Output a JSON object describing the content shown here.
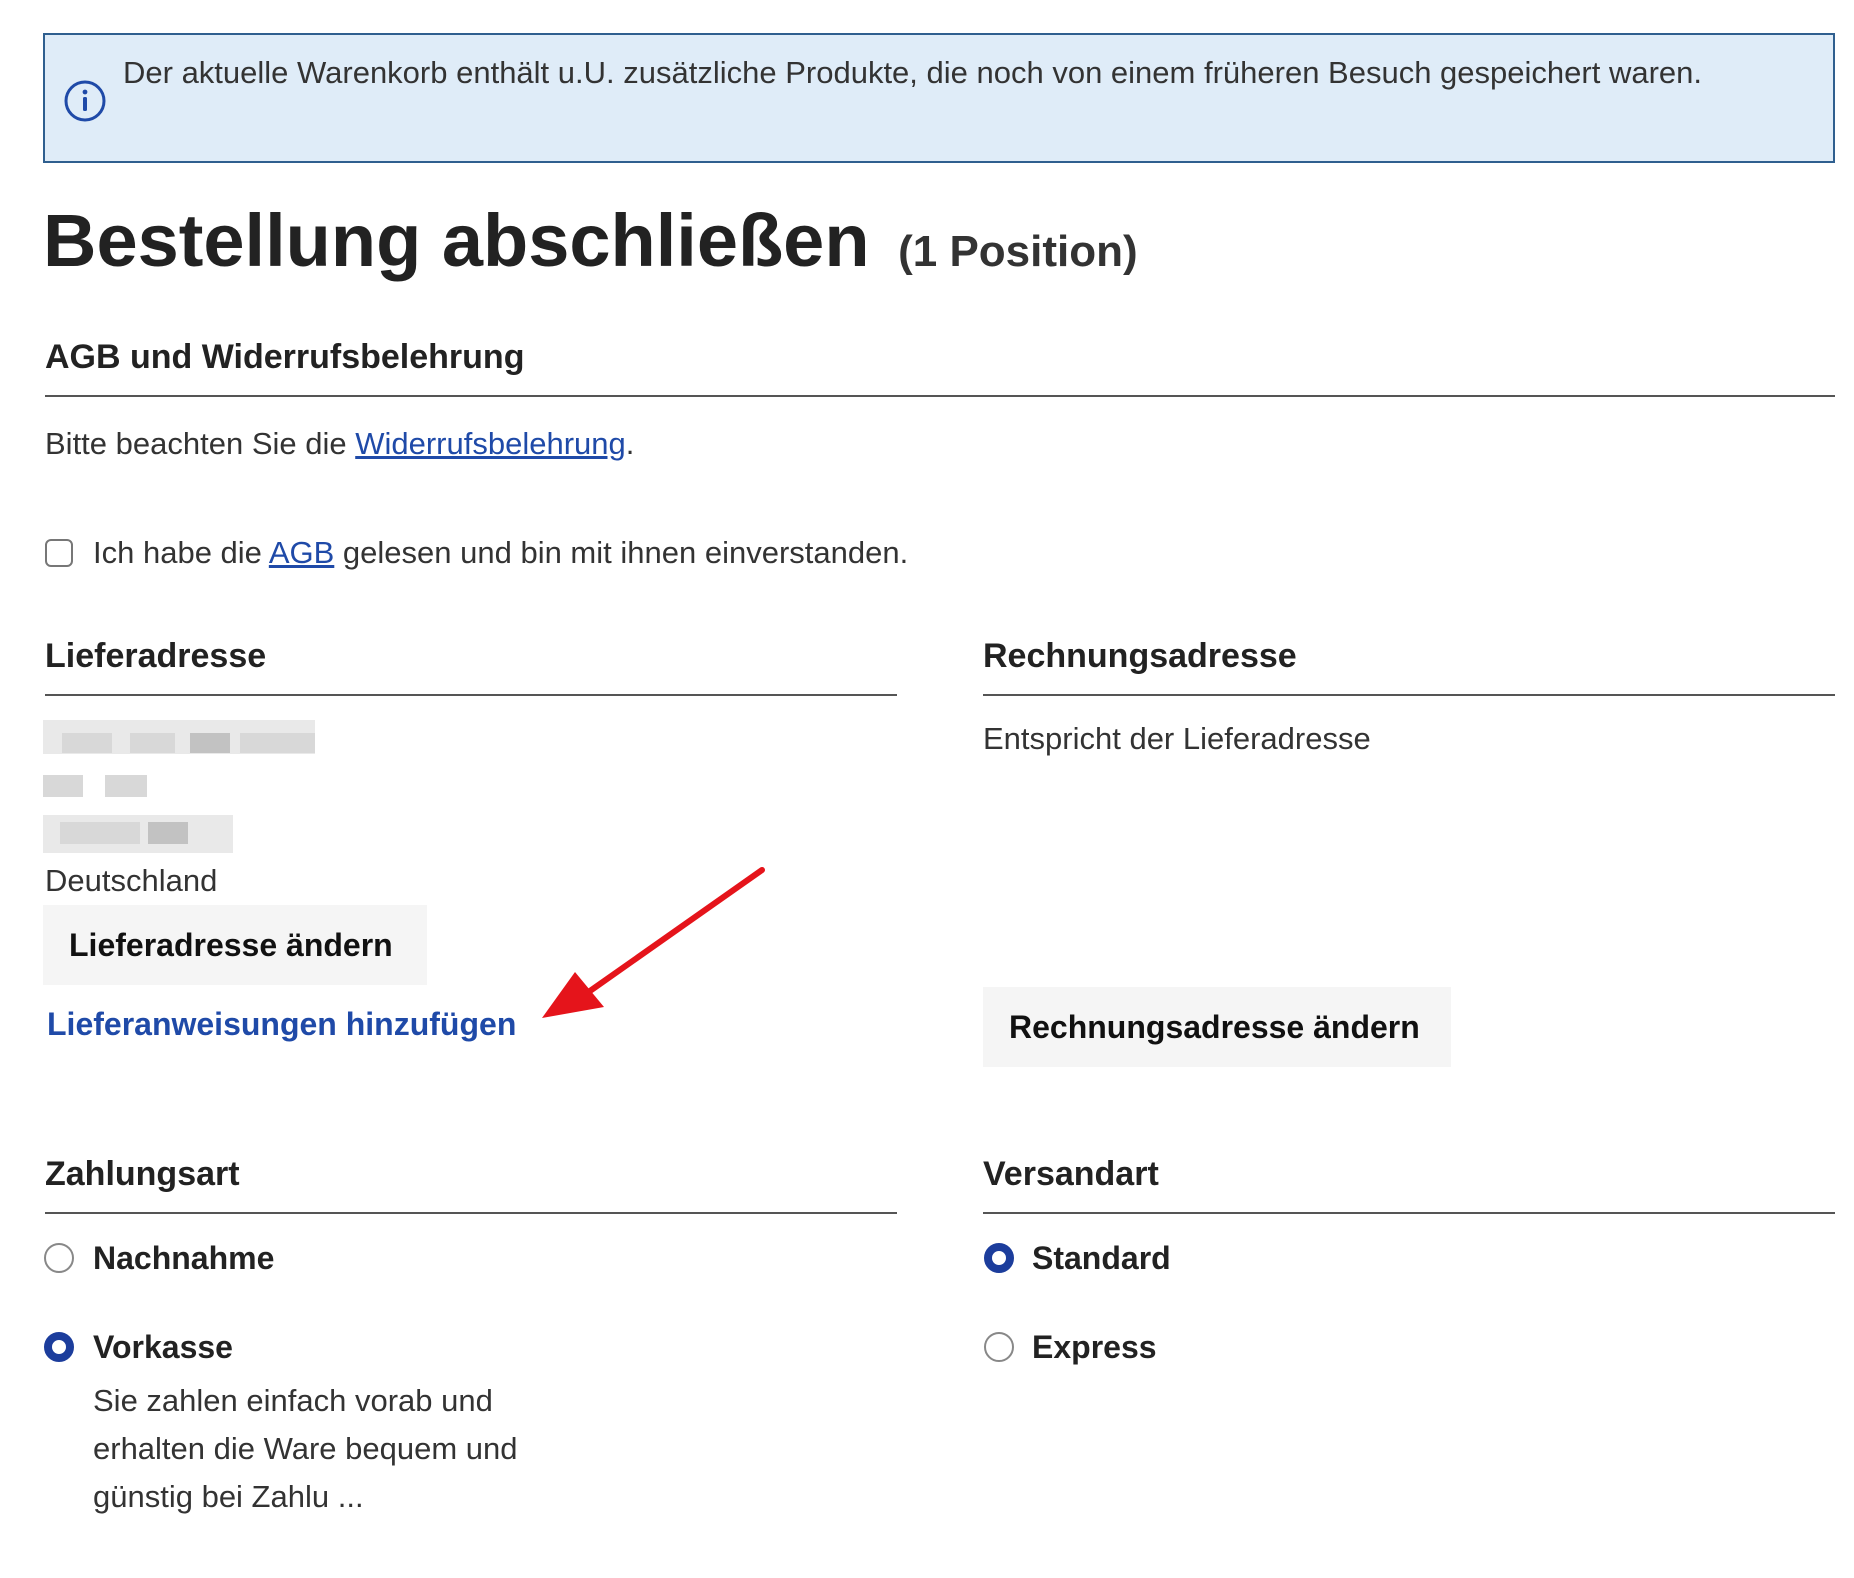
{
  "alert": {
    "text": "Der aktuelle Warenkorb enthält u.U. zusätzliche Produkte, die noch von einem früheren Besuch gespeichert waren.",
    "icon": "info-circle-icon"
  },
  "page": {
    "title": "Bestellung abschließen",
    "count": "(1 Position)"
  },
  "agb_section": {
    "heading": "AGB und Widerrufsbelehrung",
    "notice_prefix": "Bitte beachten Sie die ",
    "notice_link": "Widerrufsbelehrung",
    "notice_suffix": ".",
    "checkbox_prefix": "Ich habe die ",
    "checkbox_link": "AGB",
    "checkbox_suffix": " gelesen und bin mit ihnen einverstanden.",
    "checked": false
  },
  "delivery": {
    "heading": "Lieferadresse",
    "country": "Deutschland",
    "change_button": "Lieferadresse ändern",
    "instructions_link": "Lieferanweisungen hinzufügen"
  },
  "billing": {
    "heading": "Rechnungsadresse",
    "same_as_delivery": "Entspricht der Lieferadresse",
    "change_button": "Rechnungsadresse ändern"
  },
  "payment": {
    "heading": "Zahlungsart",
    "options": [
      {
        "label": "Nachnahme",
        "selected": false
      },
      {
        "label": "Vorkasse",
        "selected": true,
        "description": [
          "Sie zahlen einfach vorab und",
          "erhalten die Ware bequem und",
          "günstig bei Zahlu ..."
        ]
      }
    ]
  },
  "shipping": {
    "heading": "Versandart",
    "options": [
      {
        "label": "Standard",
        "selected": true
      },
      {
        "label": "Express",
        "selected": false
      }
    ]
  },
  "colors": {
    "accent": "#1c3d9c",
    "link": "#1f4aa8",
    "alert_bg": "#dfecf8",
    "alert_border": "#2f5f8f",
    "annotation_arrow": "#e5141b"
  }
}
